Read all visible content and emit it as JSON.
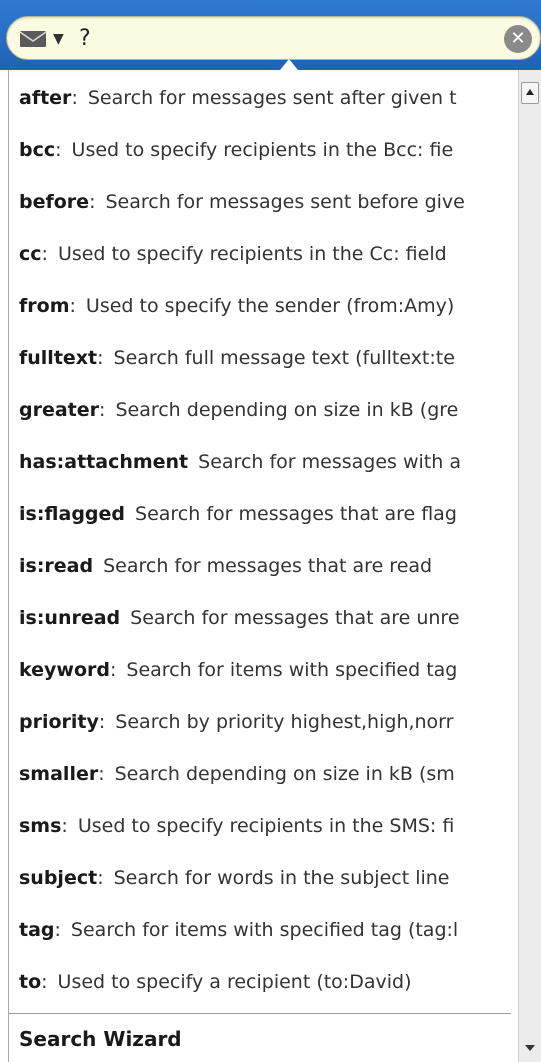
{
  "search": {
    "query": "?",
    "scope_icon": "envelope-icon",
    "dropdown_icon": "caret-down-icon",
    "clear_icon": "clear-circle-icon"
  },
  "suggestions": [
    {
      "keyword": "after",
      "colon": ":",
      "description": "Search for messages sent after given t"
    },
    {
      "keyword": "bcc",
      "colon": ":",
      "description": "Used to specify recipients in the Bcc: fie"
    },
    {
      "keyword": "before",
      "colon": ":",
      "description": "Search for messages sent before give"
    },
    {
      "keyword": "cc",
      "colon": ":",
      "description": "Used to specify recipients in the Cc: field"
    },
    {
      "keyword": "from",
      "colon": ":",
      "description": "Used to specify the sender (from:Amy)"
    },
    {
      "keyword": "fulltext",
      "colon": ":",
      "description": "Search full message text (fulltext:te"
    },
    {
      "keyword": "greater",
      "colon": ":",
      "description": "Search depending on size in kB (gre"
    },
    {
      "keyword": "has:attachment",
      "colon": "",
      "description": "Search for messages with a"
    },
    {
      "keyword": "is:flagged",
      "colon": "",
      "description": "Search for messages that are flag"
    },
    {
      "keyword": "is:read",
      "colon": "",
      "description": "Search for messages that are read"
    },
    {
      "keyword": "is:unread",
      "colon": "",
      "description": "Search for messages that are unre"
    },
    {
      "keyword": "keyword",
      "colon": ":",
      "description": "Search for items with specified tag"
    },
    {
      "keyword": "priority",
      "colon": ":",
      "description": "Search by priority highest,high,norr"
    },
    {
      "keyword": "smaller",
      "colon": ":",
      "description": "Search depending on size in kB (sm"
    },
    {
      "keyword": "sms",
      "colon": ":",
      "description": "Used to specify recipients in the SMS: fi"
    },
    {
      "keyword": "subject",
      "colon": ":",
      "description": "Search for words in the subject line"
    },
    {
      "keyword": "tag",
      "colon": ":",
      "description": "Search for items with specified tag (tag:l"
    },
    {
      "keyword": "to",
      "colon": ":",
      "description": "Used to specify a recipient (to:David)"
    }
  ],
  "footer": {
    "wizard_label": "Search Wizard"
  },
  "colors": {
    "topbar": "#2a72c8",
    "search_field": "#fbfbe2"
  }
}
